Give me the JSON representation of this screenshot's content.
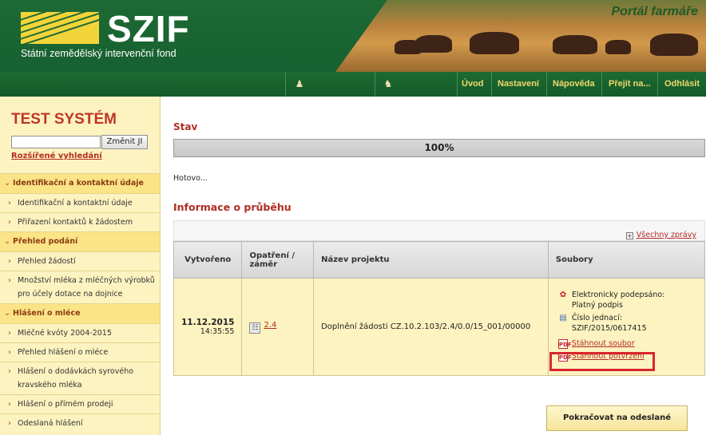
{
  "header": {
    "logo_text": "SZIF",
    "logo_subtitle": "Státní zemědělský intervenční fond",
    "portal_title": "Portál farmáře"
  },
  "nav": {
    "items": [
      {
        "label": "Úvod"
      },
      {
        "label": "Nastavení"
      },
      {
        "label": "Nápověda"
      },
      {
        "label": "Přejít na..."
      },
      {
        "label": "Odhlásit"
      }
    ]
  },
  "sidebar": {
    "title": "TEST SYSTÉM",
    "search_value": "",
    "change_button": "Změnit JI",
    "advanced_search": "Rozšířené vyhledání",
    "items": [
      {
        "label": "Identifikační a kontaktní údaje",
        "section": true
      },
      {
        "label": "Identifikační a kontaktní údaje",
        "section": false
      },
      {
        "label": "Přiřazení kontaktů k žádostem",
        "section": false
      },
      {
        "label": "Přehled podání",
        "section": true
      },
      {
        "label": "Přehled žádostí",
        "section": false
      },
      {
        "label": "Množství mléka z mléčných výrobků pro účely dotace na dojnice",
        "section": false
      },
      {
        "label": "Hlášení o mléce",
        "section": true
      },
      {
        "label": "Mléčné kvóty 2004-2015",
        "section": false
      },
      {
        "label": "Přehled hlášení o mléce",
        "section": false
      },
      {
        "label": "Hlášení o dodávkách syrového kravského mléka",
        "section": false
      },
      {
        "label": "Hlášení o přímém prodeji",
        "section": false
      },
      {
        "label": "Odeslaná hlášení",
        "section": false
      }
    ]
  },
  "main": {
    "status_heading": "Stav",
    "progress_value": 100,
    "progress_label": "100%",
    "done_text": "Hotovo...",
    "info_heading": "Informace o průběhu",
    "all_messages": "Všechny zprávy",
    "table": {
      "headers": [
        "Vytvořeno",
        "Opatření / záměr",
        "Název projektu",
        "Soubory"
      ],
      "row": {
        "date": "11.12.2015",
        "time": "14:35:55",
        "measure": "2.4",
        "project": "Doplnění žádosti CZ.10.2.103/2.4/0.0/15_001/00000",
        "signed_label": "Elektronicky podepsáno:",
        "signed_value": "Platný podpis",
        "ref_label": "Číslo jednací:",
        "ref_value": "SZIF/2015/0617415",
        "download_file": "Stáhnout soubor",
        "download_confirmation": "Stáhnout potvrzení"
      }
    },
    "continue_button": "Pokračovat na odeslané žádosti"
  },
  "colors": {
    "brand_green": "#1d6a34",
    "accent_red": "#b22c22",
    "sidebar_bg": "#fdf3c0",
    "highlight": "#d8262c"
  }
}
